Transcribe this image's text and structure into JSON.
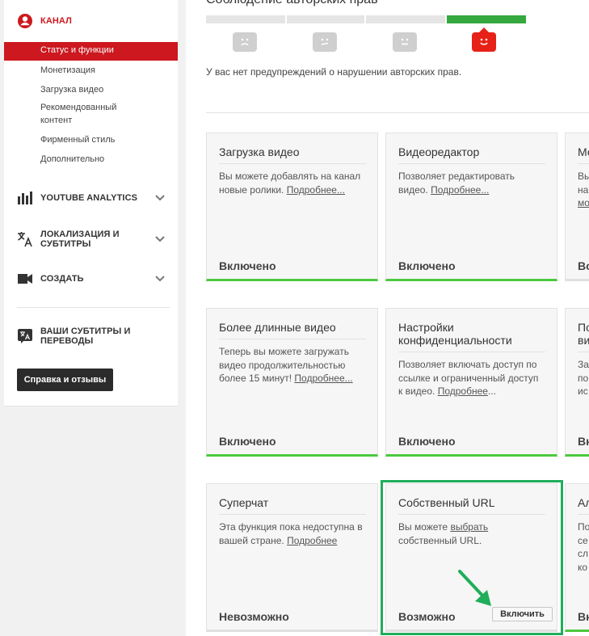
{
  "sidebar": {
    "channel_label": "КАНАЛ",
    "channel_items": [
      "Статус и функции",
      "Монетизация",
      "Загрузка видео",
      "Рекомендованный",
      "контент",
      "Фирменный стиль",
      "Дополнительно"
    ],
    "analytics_label": "YOUTUBE ANALYTICS",
    "localization_label_1": "ЛОКАЛИЗАЦИЯ И",
    "localization_label_2": "СУБТИТРЫ",
    "create_label": "СОЗДАТЬ",
    "subtitles_label_1": "ВАШИ СУБТИТРЫ И",
    "subtitles_label_2": "ПЕРЕВОДЫ",
    "help_button": "Справка и отзывы"
  },
  "copyright": {
    "title": "Соблюдение авторских прав",
    "note": "У вас нет предупреждений о нарушении авторских прав."
  },
  "cards": [
    {
      "title": "Загрузка видео",
      "desc_1": "Вы можете добавлять на канал",
      "desc_2": "новые ролики. ",
      "link": "Подробнее...",
      "status": "Включено"
    },
    {
      "title": "Видеоредактор",
      "desc_1": "Позволяет редактировать",
      "desc_2": "видео. ",
      "link": "Подробнее...",
      "status": "Включено"
    },
    {
      "title": "Мо",
      "desc_1": "Вы",
      "desc_2": "на",
      "link": "мо",
      "status": "Во"
    },
    {
      "title": "Более длинные видео",
      "desc_1": "Теперь вы можете загружать",
      "desc_2": "видео продолжительностью",
      "desc_3": "более 15 минут! ",
      "link": "Подробнее...",
      "status": "Включено"
    },
    {
      "title": "Настройки",
      "title_2": "конфиденциальности",
      "desc_1": "Позволяет включать доступ по",
      "desc_2": "ссылке и ограниченный доступ",
      "desc_3": "к видео. ",
      "link": "Подробнее",
      "link_tail": "...",
      "status": "Включено"
    },
    {
      "title": "По",
      "title_2": "ви",
      "desc_1": "За",
      "desc_2": "по",
      "desc_3": "ис",
      "status": "Вк"
    },
    {
      "title": "Суперчат",
      "desc_1": "Эта функция пока недоступна в",
      "desc_2": "вашей стране. ",
      "link": "Подробнее",
      "status": "Невозможно"
    },
    {
      "title": "Собственный URL",
      "desc_1_pre": "Вы можете ",
      "desc_1_link": "выбрать",
      "desc_2": "собственный URL.",
      "status": "Возможно",
      "button": "Включить"
    },
    {
      "title": "Ал",
      "desc_1": "По",
      "desc_2": "се",
      "desc_3": "сл",
      "desc_4": "ко",
      "status": "Вк"
    }
  ],
  "colors": {
    "accent_red": "#cc181e",
    "status_green": "#4cc93f",
    "highlight_green": "#1fae5a"
  }
}
